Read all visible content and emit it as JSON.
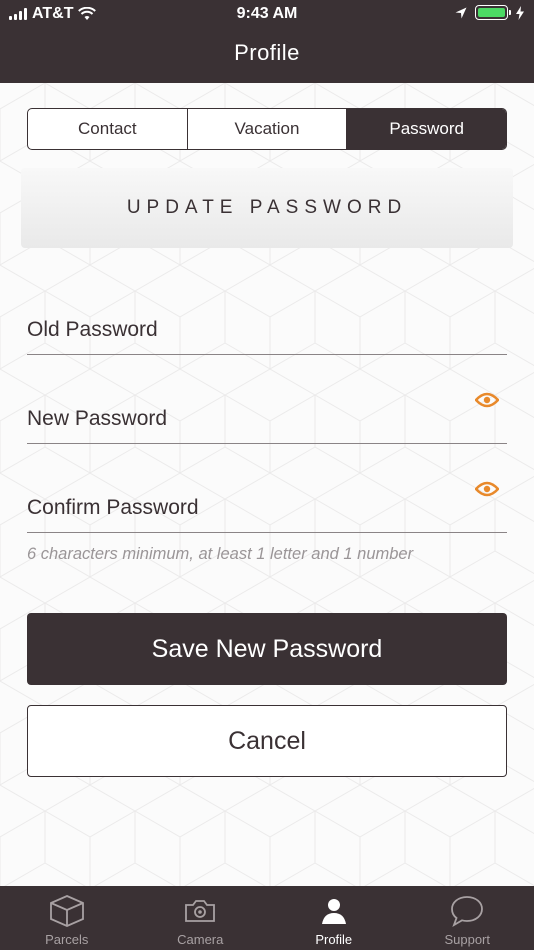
{
  "status_bar": {
    "carrier": "AT&T",
    "time": "9:43 AM"
  },
  "header": {
    "title": "Profile"
  },
  "segments": [
    {
      "label": "Contact",
      "active": false
    },
    {
      "label": "Vacation",
      "active": false
    },
    {
      "label": "Password",
      "active": true
    }
  ],
  "section": {
    "title": "UPDATE PASSWORD"
  },
  "fields": {
    "old_password": {
      "placeholder": "Old Password",
      "value": ""
    },
    "new_password": {
      "placeholder": "New Password",
      "value": ""
    },
    "confirm_password": {
      "placeholder": "Confirm Password",
      "value": ""
    }
  },
  "hint": "6 characters minimum, at least 1 letter and 1 number",
  "buttons": {
    "save_label": "Save New Password",
    "cancel_label": "Cancel"
  },
  "tabbar": {
    "items": [
      {
        "label": "Parcels",
        "icon": "box-icon",
        "active": false
      },
      {
        "label": "Camera",
        "icon": "camera-icon",
        "active": false
      },
      {
        "label": "Profile",
        "icon": "person-icon",
        "active": true
      },
      {
        "label": "Support",
        "icon": "speech-bubble-icon",
        "active": false
      }
    ]
  },
  "colors": {
    "brand_dark": "#3a3134",
    "accent_orange": "#e8892b",
    "battery_green": "#4cd964"
  }
}
